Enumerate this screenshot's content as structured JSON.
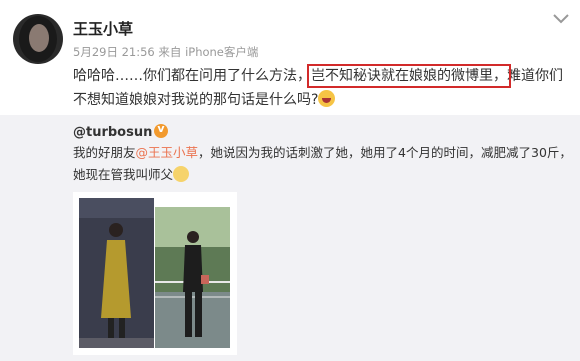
{
  "post": {
    "author": "王玉小草",
    "date": "5月29日 21:56",
    "source_prefix": "来自",
    "source": "iPhone客户端",
    "text_before": "哈哈哈……你们都在问用了什么方法，",
    "text_highlight": "岂不知秘诀就在娘娘的微博里，",
    "text_after": "难道你们不想知道娘娘对我说的那句话是什么吗?",
    "emoji_icon": "laughing-emoji-icon"
  },
  "repost": {
    "author": "@turbosun",
    "text_before": "我的好朋友",
    "mention": "@王玉小草",
    "text_after": "，她说因为我的话刺激了她，她用了4个月的时间，减肥减了30斤，她现在管我叫师父",
    "end_emoji_icon": "gold-emoji-icon"
  },
  "colors": {
    "highlight_border": "#d22a2a",
    "mention": "#eb7350",
    "repost_bg": "#f2f2f5"
  }
}
